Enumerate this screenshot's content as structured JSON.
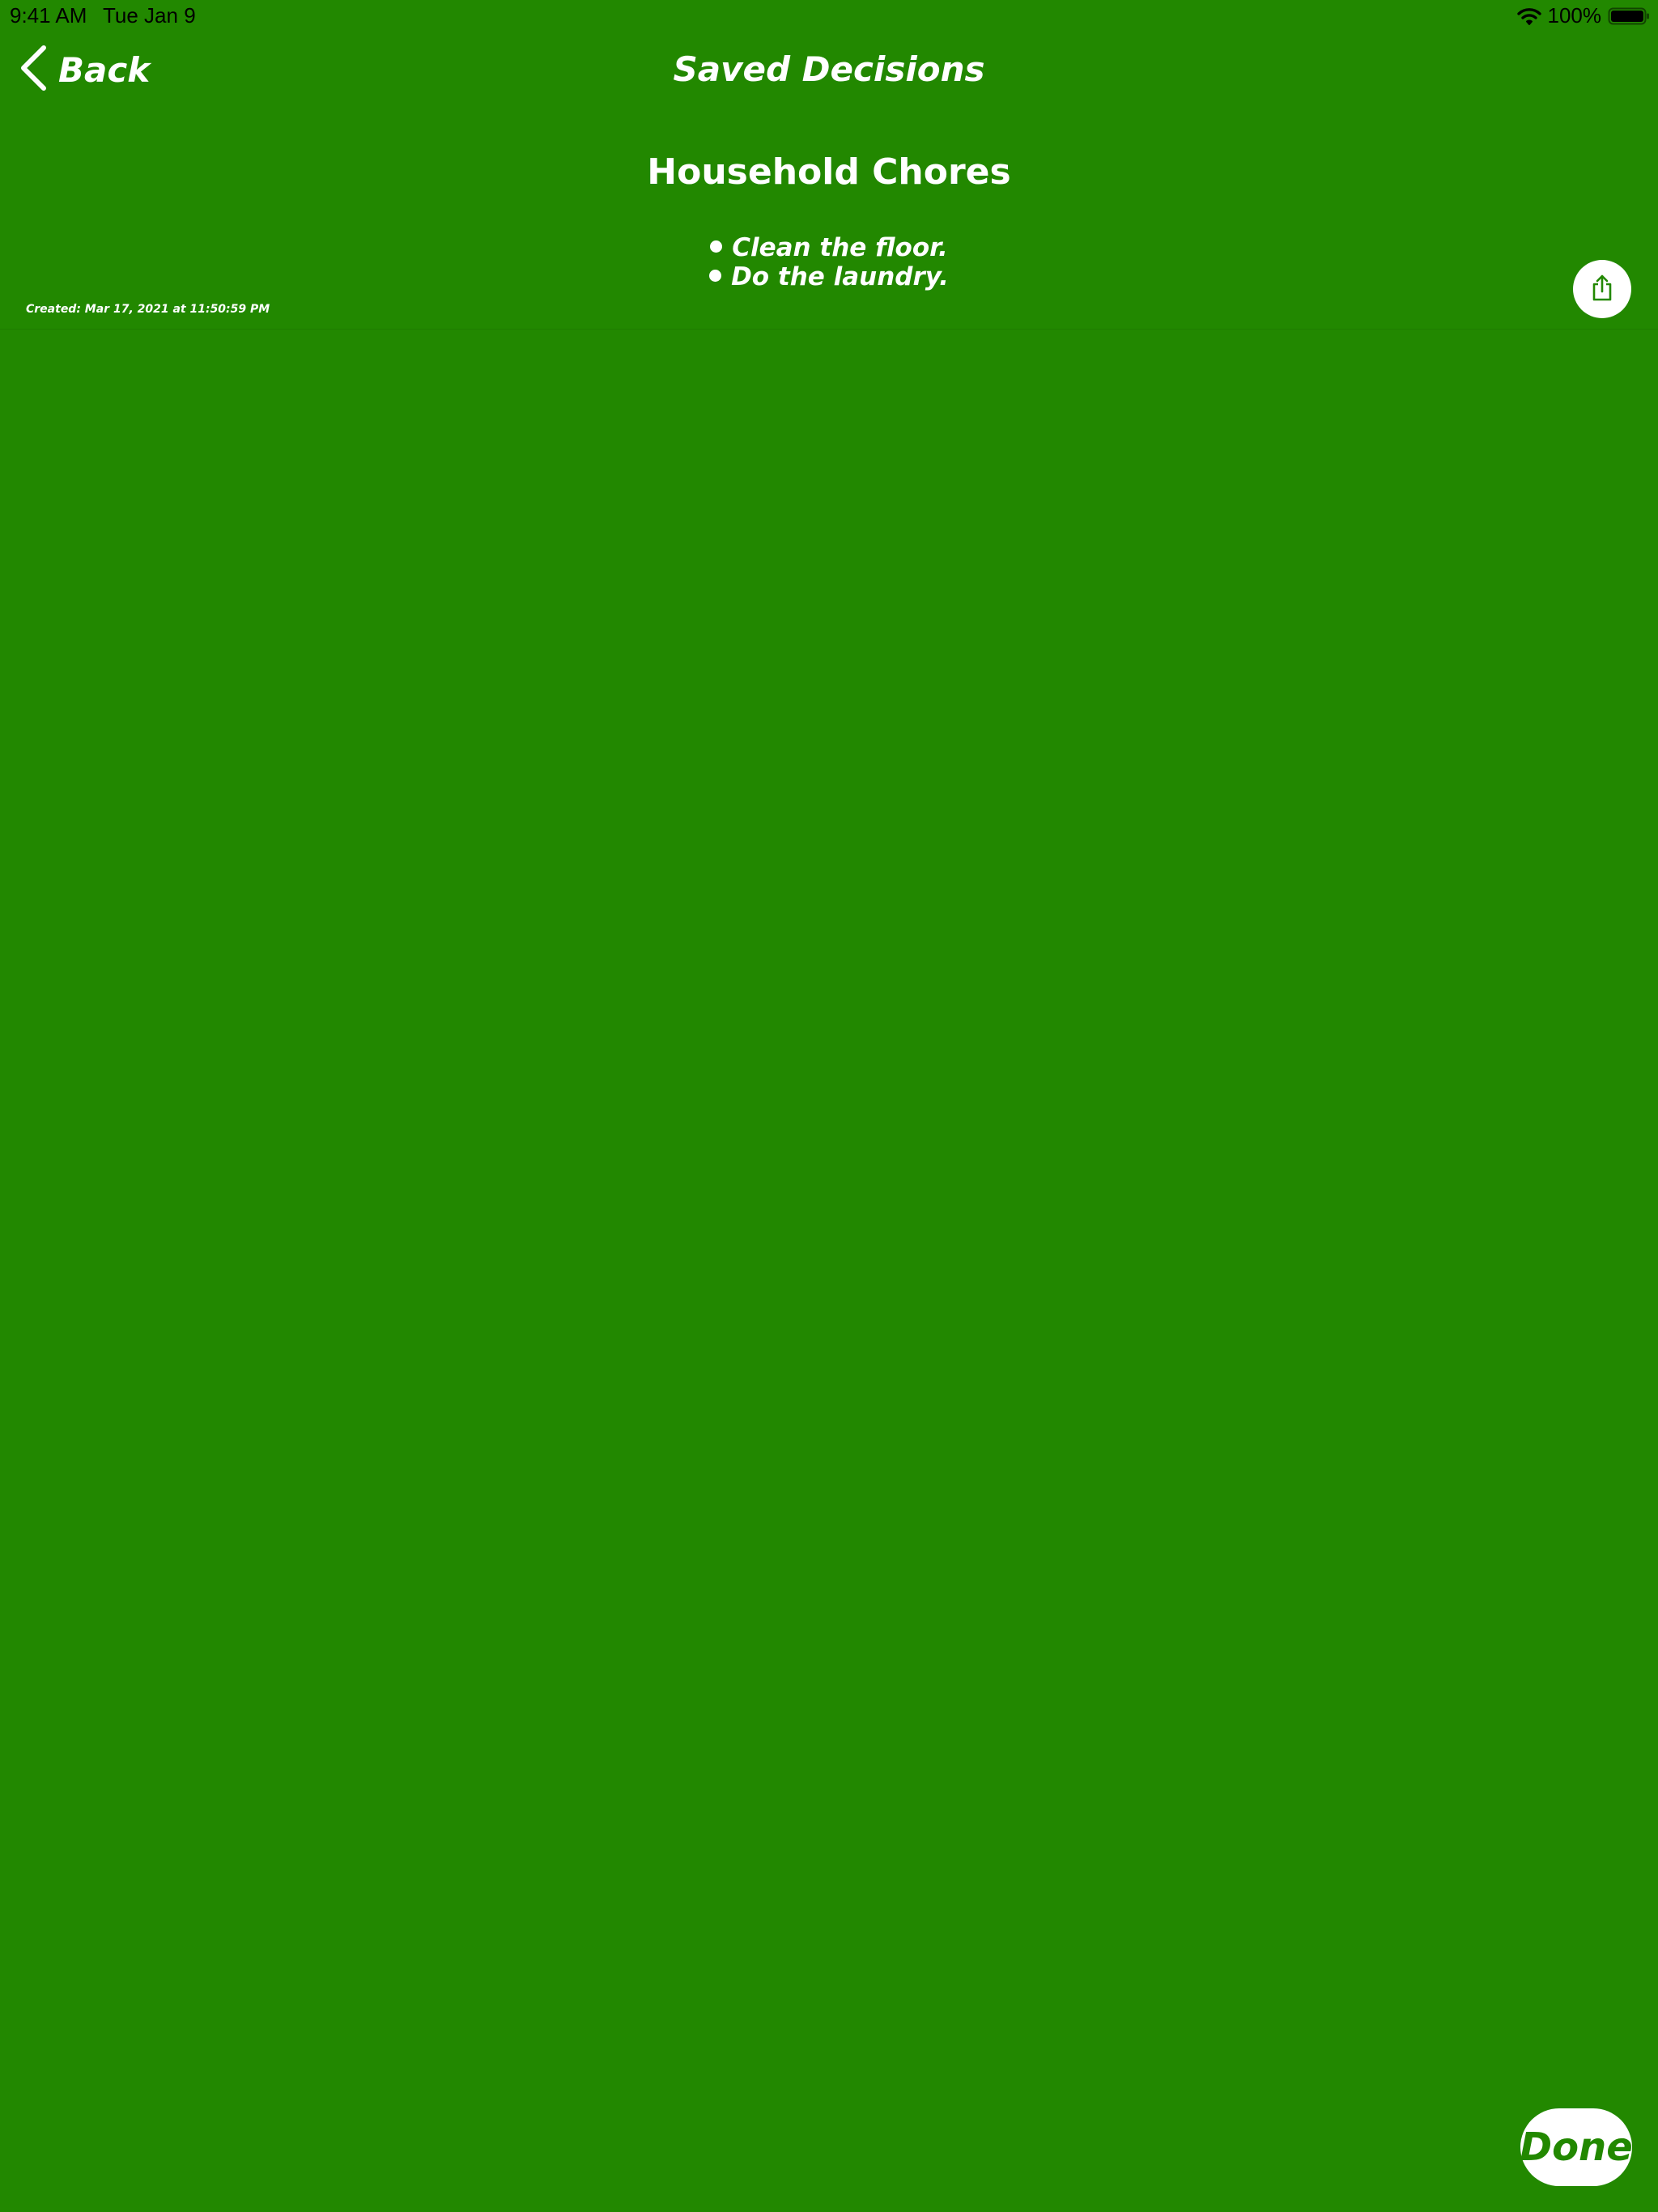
{
  "status_bar": {
    "time": "9:41 AM",
    "date": "Tue Jan 9",
    "battery_percent": "100%",
    "icons": [
      "wifi-icon",
      "battery-icon"
    ]
  },
  "nav": {
    "back_label": "Back",
    "back_icon": "chevron-left-icon",
    "title": "Saved Decisions"
  },
  "decision": {
    "title": "Household Chores",
    "items": [
      "Clean the floor.",
      "Do the laundry."
    ],
    "created": "Created: Mar 17, 2021 at 11:50:59 PM",
    "share_icon": "share-icon"
  },
  "actions": {
    "done_label": "Done"
  },
  "colors": {
    "background": "#228800",
    "text": "#ffffff",
    "button_background": "#ffffff",
    "accent": "#228800",
    "status_text": "#000000"
  }
}
